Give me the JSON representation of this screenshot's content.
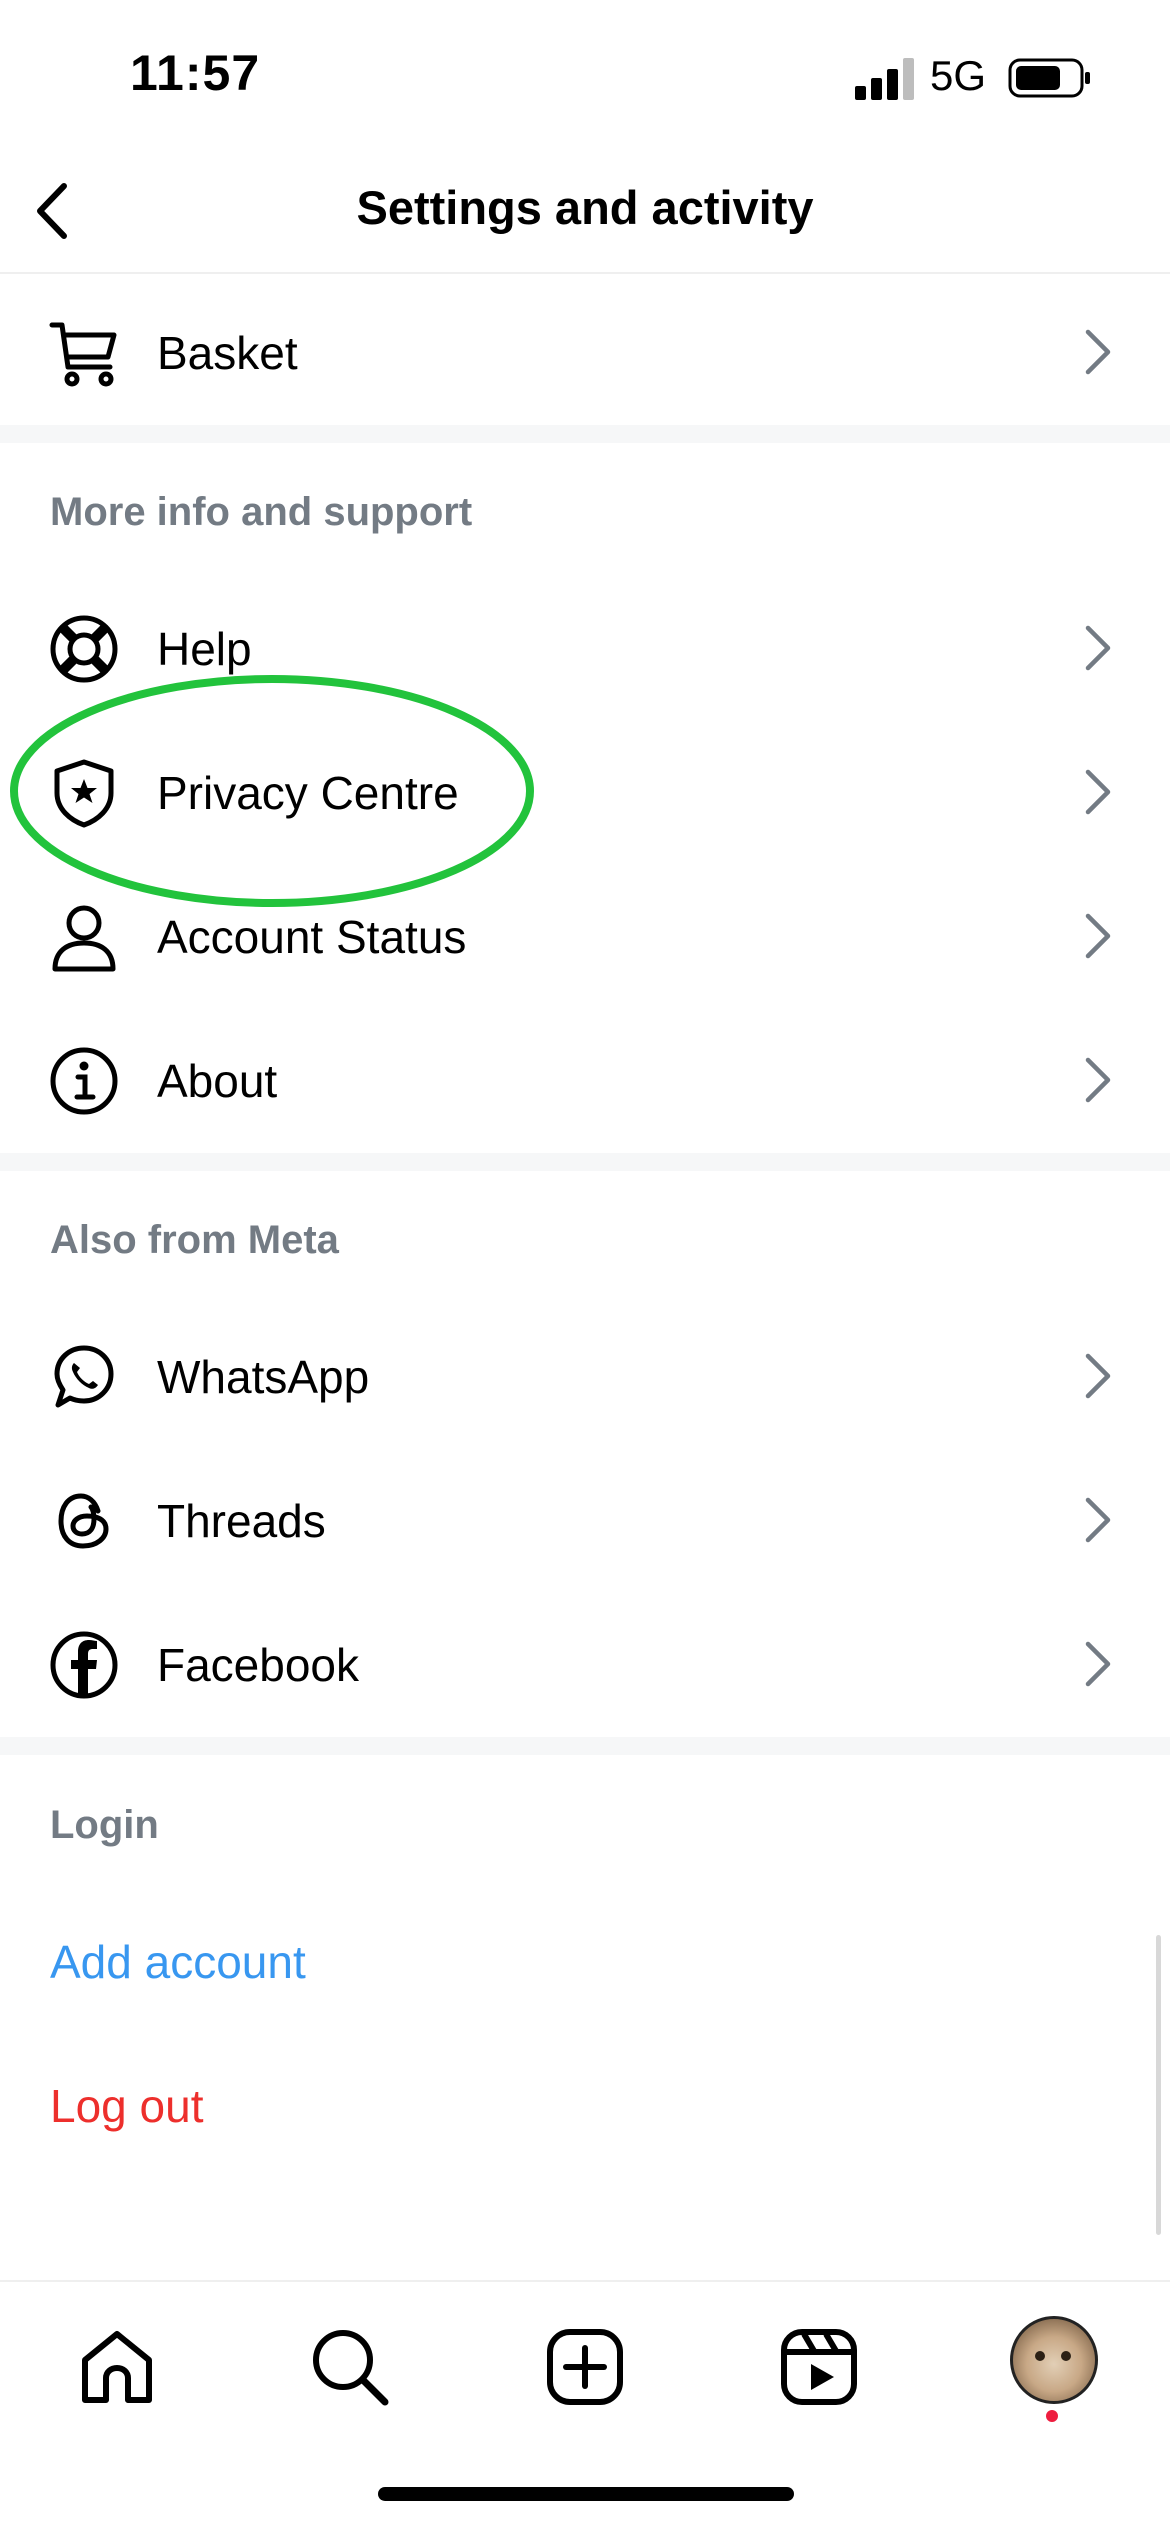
{
  "status_bar": {
    "time": "11:57",
    "network": "5G",
    "battery_level": 0.7
  },
  "nav": {
    "title": "Settings and activity"
  },
  "top_items": [
    {
      "label": "Basket",
      "icon": "cart-icon"
    }
  ],
  "more_info": {
    "header": "More info and support",
    "items": [
      {
        "label": "Help",
        "icon": "lifebuoy-icon"
      },
      {
        "label": "Privacy Centre",
        "icon": "shield-star-icon"
      },
      {
        "label": "Account Status",
        "icon": "person-icon"
      },
      {
        "label": "About",
        "icon": "info-icon"
      }
    ]
  },
  "meta": {
    "header": "Also from Meta",
    "items": [
      {
        "label": "WhatsApp",
        "icon": "whatsapp-icon"
      },
      {
        "label": "Threads",
        "icon": "threads-icon"
      },
      {
        "label": "Facebook",
        "icon": "facebook-icon"
      }
    ]
  },
  "login": {
    "header": "Login",
    "add_account": "Add account",
    "log_out": "Log out"
  },
  "colors": {
    "link_blue": "#3897f0",
    "logout_red": "#ed2f2c",
    "highlight_green": "#22c33c",
    "header_gray": "#737b84"
  },
  "tabs": [
    {
      "name": "home",
      "icon": "home-icon"
    },
    {
      "name": "search",
      "icon": "search-icon"
    },
    {
      "name": "create",
      "icon": "create-icon"
    },
    {
      "name": "reels",
      "icon": "reels-icon"
    },
    {
      "name": "profile",
      "icon": "avatar"
    }
  ]
}
